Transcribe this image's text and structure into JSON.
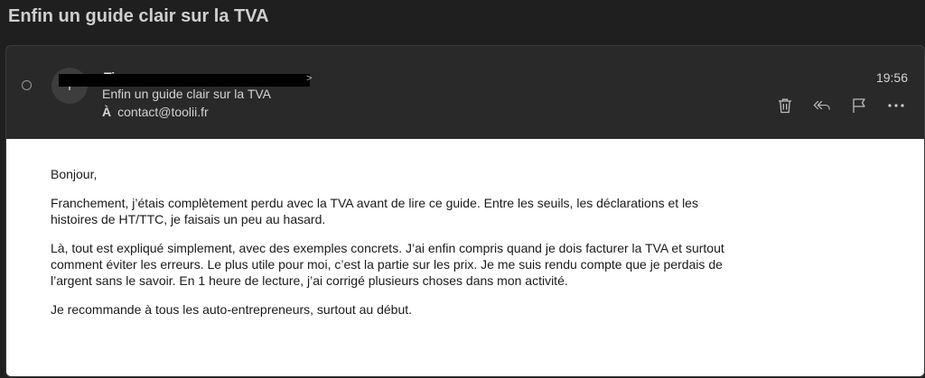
{
  "thread": {
    "subject": "Enfin un guide clair sur la TVA"
  },
  "message": {
    "sender_name": "Ti",
    "sender_chevron": ">",
    "avatar_initial": "T",
    "subject": "Enfin un guide clair sur la TVA",
    "to_label": "À",
    "to_address": "contact@toolii.fr",
    "time": "19:56"
  },
  "actions": {
    "icons": [
      "trash-icon",
      "reply-all-icon",
      "flag-icon",
      "more-icon"
    ]
  },
  "body": {
    "greeting": "Bonjour,",
    "paragraph_1": "Franchement, j’étais complètement perdu avec la TVA avant de lire ce guide. Entre les seuils, les déclarations et les histoires de HT/TTC, je faisais un peu au hasard.",
    "paragraph_2": "Là, tout est expliqué simplement, avec des exemples concrets. J’ai enfin compris quand je dois facturer la TVA et surtout comment éviter les erreurs. Le plus utile pour moi, c’est la partie sur les prix. Je me suis rendu compte que je perdais de l’argent sans le savoir. En 1 heure de lecture, j’ai corrigé plusieurs choses dans mon activité.",
    "paragraph_3": "Je recommande à tous les auto-entrepreneurs, surtout au début."
  },
  "colors": {
    "background": "#1f1f1f",
    "header": "#292929",
    "body": "#ffffff",
    "redaction": "#000000"
  }
}
